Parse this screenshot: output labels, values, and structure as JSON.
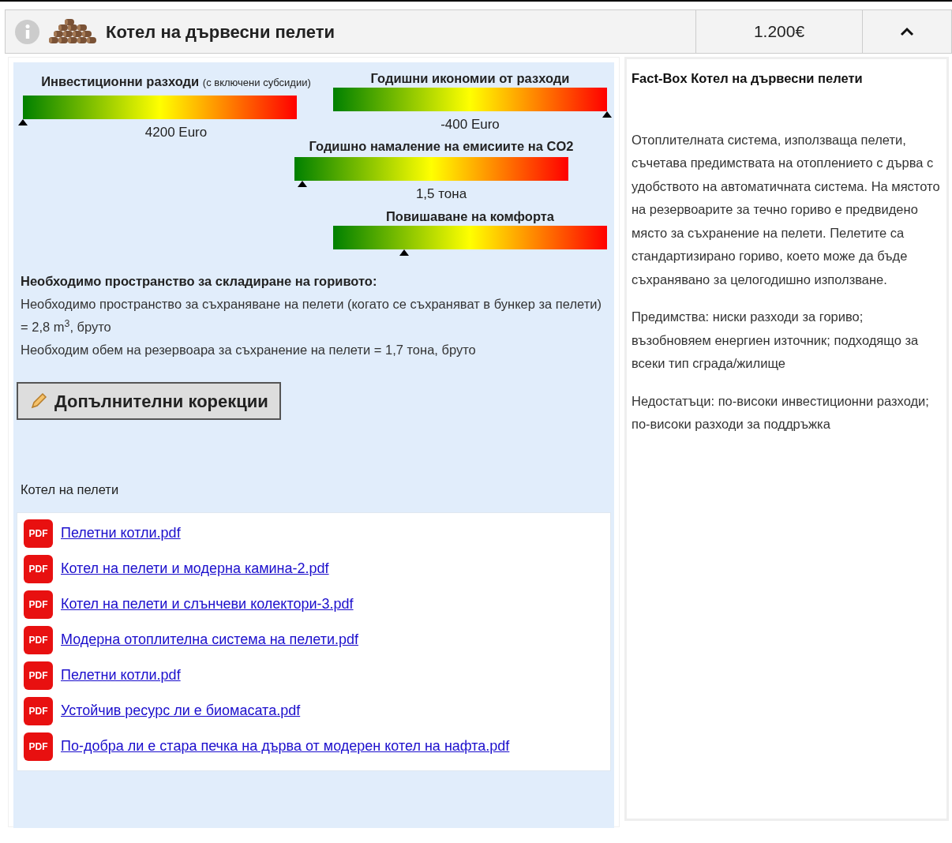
{
  "header": {
    "title": "Котел на дървесни пелети",
    "price": "1.200€",
    "expanded": true
  },
  "gauges": [
    {
      "title": "Инвестиционни разходи",
      "note": "(с включени субсидии)",
      "level": 0,
      "reading": "4200 Euro"
    },
    {
      "title": "Годишни икономии от разходи",
      "level": 1,
      "reading": "-400 Euro"
    },
    {
      "title": "Годишно намаление на емисиите на CO2",
      "level": 0.03,
      "reading": "1,5 тона"
    },
    {
      "title": "Повишаване на комфорта",
      "level": 0.26
    }
  ],
  "storage": {
    "heading": "Необходимо пространство за складиране на горивото:",
    "lines": [
      "Необходимо пространство за съхраняване на пелети (когато се съхраняват в бункер за пелети) = 2,8 m$^{3}$, бруто",
      "Необходим обем на резервоара за съхранение на пелети = 1,7 тона, бруто"
    ]
  },
  "corrections_button": "Допълнителни корекции",
  "documents_title": "Котел на пелети",
  "documents": [
    {
      "icon_label": "PDF",
      "name": "Пелетни котли.pdf"
    },
    {
      "icon_label": "PDF",
      "name": "Котел на пелети и модерна камина-2.pdf"
    },
    {
      "icon_label": "PDF",
      "name": "Котел на пелети и слънчеви колектори-3.pdf"
    },
    {
      "icon_label": "PDF",
      "name": "Модерна отоплителна система на пелети.pdf"
    },
    {
      "icon_label": "PDF",
      "name": "Пелетни котли.pdf"
    },
    {
      "icon_label": "PDF",
      "name": "Устойчив ресурс ли е биомасата.pdf"
    },
    {
      "icon_label": "PDF",
      "name": "По-добра ли е стара печка на дърва от модерен котел на нафта.pdf"
    }
  ],
  "fact_box": {
    "title": "Fact-Box Котел на дървесни пелети",
    "paragraphs": [
      "Отоплителната система, използваща пелети, съчетава предимствата на отоплението с дърва с удобството на автоматичната система. На мястото на резервоарите за течно гориво е предвидено място за съхранение на пелети. Пелетите са стандартизирано гориво, което може да бъде съхранявано за целогодишно използване.",
      "Предимства: ниски разходи за гориво; възобновяем енергиен източник; подходящо за всеки тип сграда/жилище",
      "Недостатъци: по-високи инвестиционни разходи; по-високи разходи за поддръжка"
    ]
  }
}
